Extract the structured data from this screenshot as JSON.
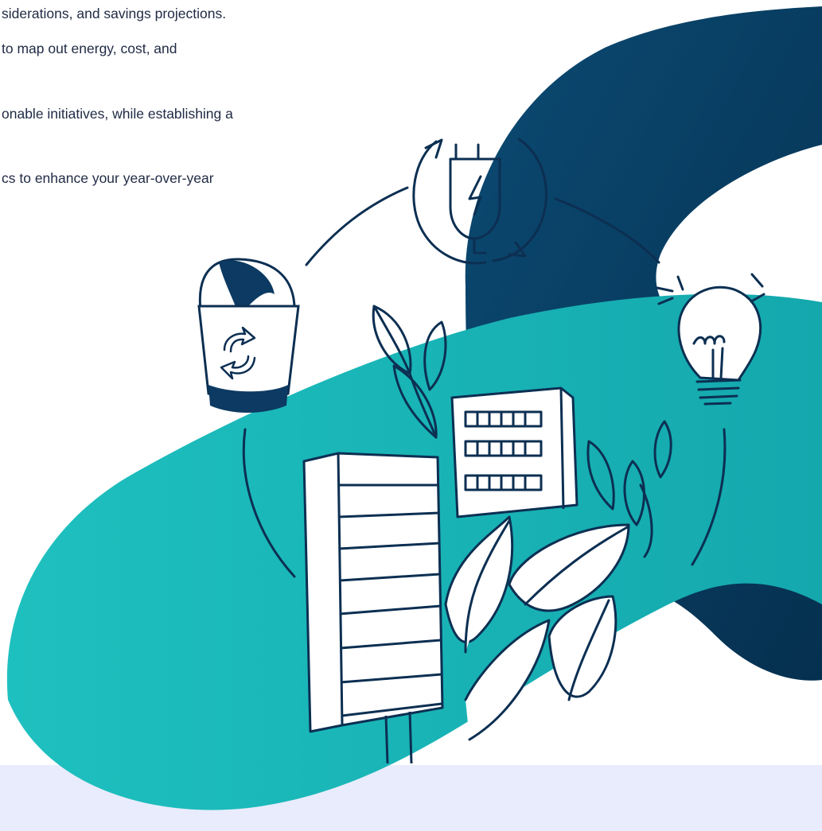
{
  "text_lines": [
    "siderations, and savings projections.",
    "to map out energy, cost, and",
    "onable initiatives, while establishing a",
    "cs to enhance your year-over-year"
  ],
  "colors": {
    "navy": "#0a3d62",
    "navy_dark": "#073356",
    "teal": "#19b8b8",
    "stroke": "#0c2f52",
    "band": "#e8ecfd"
  },
  "illustration": {
    "icons": [
      "recycle-bin-icon",
      "plug-energy-icon",
      "lightbulb-icon",
      "building-icon",
      "plants-icon"
    ]
  }
}
